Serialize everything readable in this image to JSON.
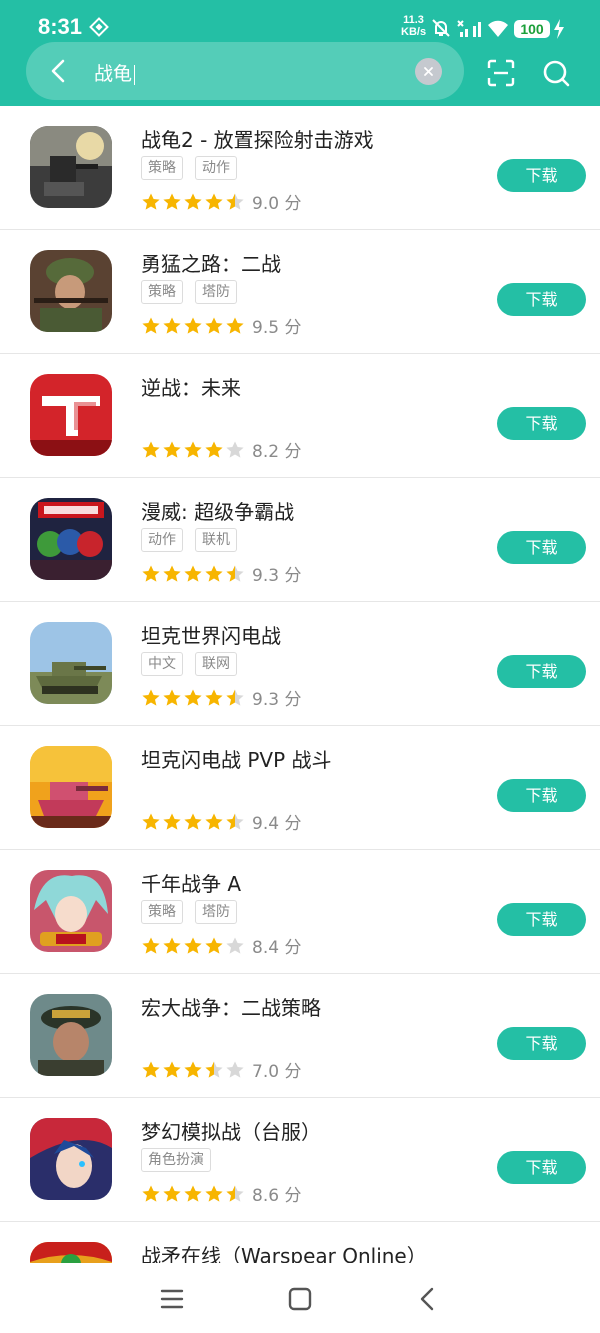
{
  "status_bar": {
    "time": "8:31",
    "net_speed_value": "11.3",
    "net_speed_unit": "KB/s",
    "battery": "100",
    "icons": [
      "app-logo-icon",
      "mute-bell-icon",
      "no-signal-icon",
      "signal-icon",
      "wifi-icon",
      "battery-icon",
      "charging-icon"
    ]
  },
  "search": {
    "query": "战龟",
    "icons": [
      "back-arrow-icon",
      "clear-icon",
      "scan-icon",
      "search-icon"
    ]
  },
  "colors": {
    "accent": "#24bfa5",
    "star": "#f7b500",
    "star_empty": "#d8d8d8",
    "battery_text": "#1b9f39"
  },
  "apps": [
    {
      "name": "战龟2 - 放置探险射击游戏",
      "tags": [
        "策略",
        "动作"
      ],
      "rating": 4.5,
      "score": "9.0 分",
      "button": "下载"
    },
    {
      "name": "勇猛之路：二战",
      "tags": [
        "策略",
        "塔防"
      ],
      "rating": 5,
      "score": "9.5 分",
      "button": "下载"
    },
    {
      "name": "逆战：未来",
      "tags": [],
      "rating": 4,
      "score": "8.2 分",
      "button": "下载"
    },
    {
      "name": "漫威: 超级争霸战",
      "tags": [
        "动作",
        "联机"
      ],
      "rating": 4.5,
      "score": "9.3 分",
      "button": "下载"
    },
    {
      "name": "坦克世界闪电战",
      "tags": [
        "中文",
        "联网"
      ],
      "rating": 4.5,
      "score": "9.3 分",
      "button": "下载"
    },
    {
      "name": "坦克闪电战 PVP 战斗",
      "tags": [],
      "rating": 4.5,
      "score": "9.4 分",
      "button": "下载"
    },
    {
      "name": "千年战争 A",
      "tags": [
        "策略",
        "塔防"
      ],
      "rating": 4,
      "score": "8.4 分",
      "button": "下载"
    },
    {
      "name": "宏大战争：二战策略",
      "tags": [],
      "rating": 3.5,
      "score": "7.0 分",
      "button": "下载"
    },
    {
      "name": "梦幻模拟战（台服）",
      "tags": [
        "角色扮演"
      ],
      "rating": 4.5,
      "score": "8.6 分",
      "button": "下载"
    },
    {
      "name": "战矛在线（Warspear Online）",
      "tags": [],
      "rating": 0,
      "score": "",
      "button": ""
    }
  ],
  "nav_bar": {
    "icons": [
      "menu-icon",
      "home-icon",
      "back-icon"
    ]
  }
}
